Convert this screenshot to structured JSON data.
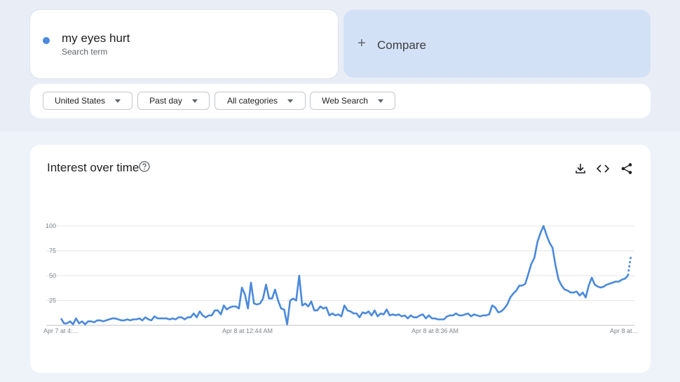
{
  "search": {
    "term": "my eyes hurt",
    "term_type": "Search term",
    "term_color": "#4a89dc",
    "compare_label": "Compare"
  },
  "filters": {
    "region": "United States",
    "time_range": "Past day",
    "category": "All categories",
    "property": "Web Search"
  },
  "panel": {
    "title": "Interest over time",
    "icons": [
      "help-icon",
      "download-icon",
      "embed-icon",
      "share-icon"
    ]
  },
  "chart_data": {
    "type": "line",
    "title": "Interest over time",
    "xlabel": "",
    "ylabel": "",
    "ylim": [
      0,
      100
    ],
    "y_ticks": [
      25,
      50,
      75,
      100
    ],
    "x_tick_labels": [
      "Apr 7 at 4:…",
      "Apr 8 at 12:44 AM",
      "Apr 8 at 8:36 AM",
      "Apr 8 at…"
    ],
    "grid": true,
    "series": [
      {
        "color": "#4a89dc",
        "values": [
          7,
          2,
          2,
          4,
          1,
          7,
          2,
          4,
          1,
          4,
          4,
          3,
          5,
          5,
          4,
          5,
          6,
          7,
          7,
          6,
          5,
          5,
          6,
          5,
          6,
          6,
          7,
          5,
          8,
          6,
          5,
          9,
          7,
          7,
          7,
          7,
          6,
          7,
          6,
          8,
          8,
          6,
          8,
          8,
          12,
          8,
          14,
          10,
          8,
          10,
          10,
          15,
          15,
          11,
          20,
          16,
          18,
          19,
          19,
          17,
          38,
          31,
          17,
          43,
          22,
          21,
          22,
          27,
          41,
          27,
          27,
          36,
          25,
          17,
          16,
          1,
          25,
          27,
          25,
          50,
          20,
          22,
          19,
          24,
          15,
          15,
          19,
          17,
          18,
          10,
          12,
          10,
          11,
          9,
          20,
          15,
          14,
          12,
          12,
          8,
          13,
          12,
          14,
          10,
          15,
          9,
          12,
          11,
          16,
          10,
          11,
          10,
          11,
          9,
          10,
          7,
          10,
          8,
          8,
          10,
          11,
          7,
          10,
          7,
          7,
          6,
          6,
          6,
          9,
          10,
          10,
          12,
          10,
          10,
          11,
          12,
          9,
          11,
          10,
          9,
          10,
          10,
          11,
          20,
          18,
          13,
          14,
          17,
          21,
          28,
          32,
          35,
          40,
          40,
          42,
          52,
          62,
          68,
          84,
          93,
          100,
          91,
          83,
          78,
          60,
          46,
          40,
          36,
          35,
          33,
          33,
          34,
          30,
          33,
          28,
          40,
          48,
          41,
          39,
          38,
          39,
          41,
          42,
          43,
          44,
          44,
          46,
          47,
          50
        ],
        "projected_values": [
          50,
          70
        ]
      }
    ]
  }
}
